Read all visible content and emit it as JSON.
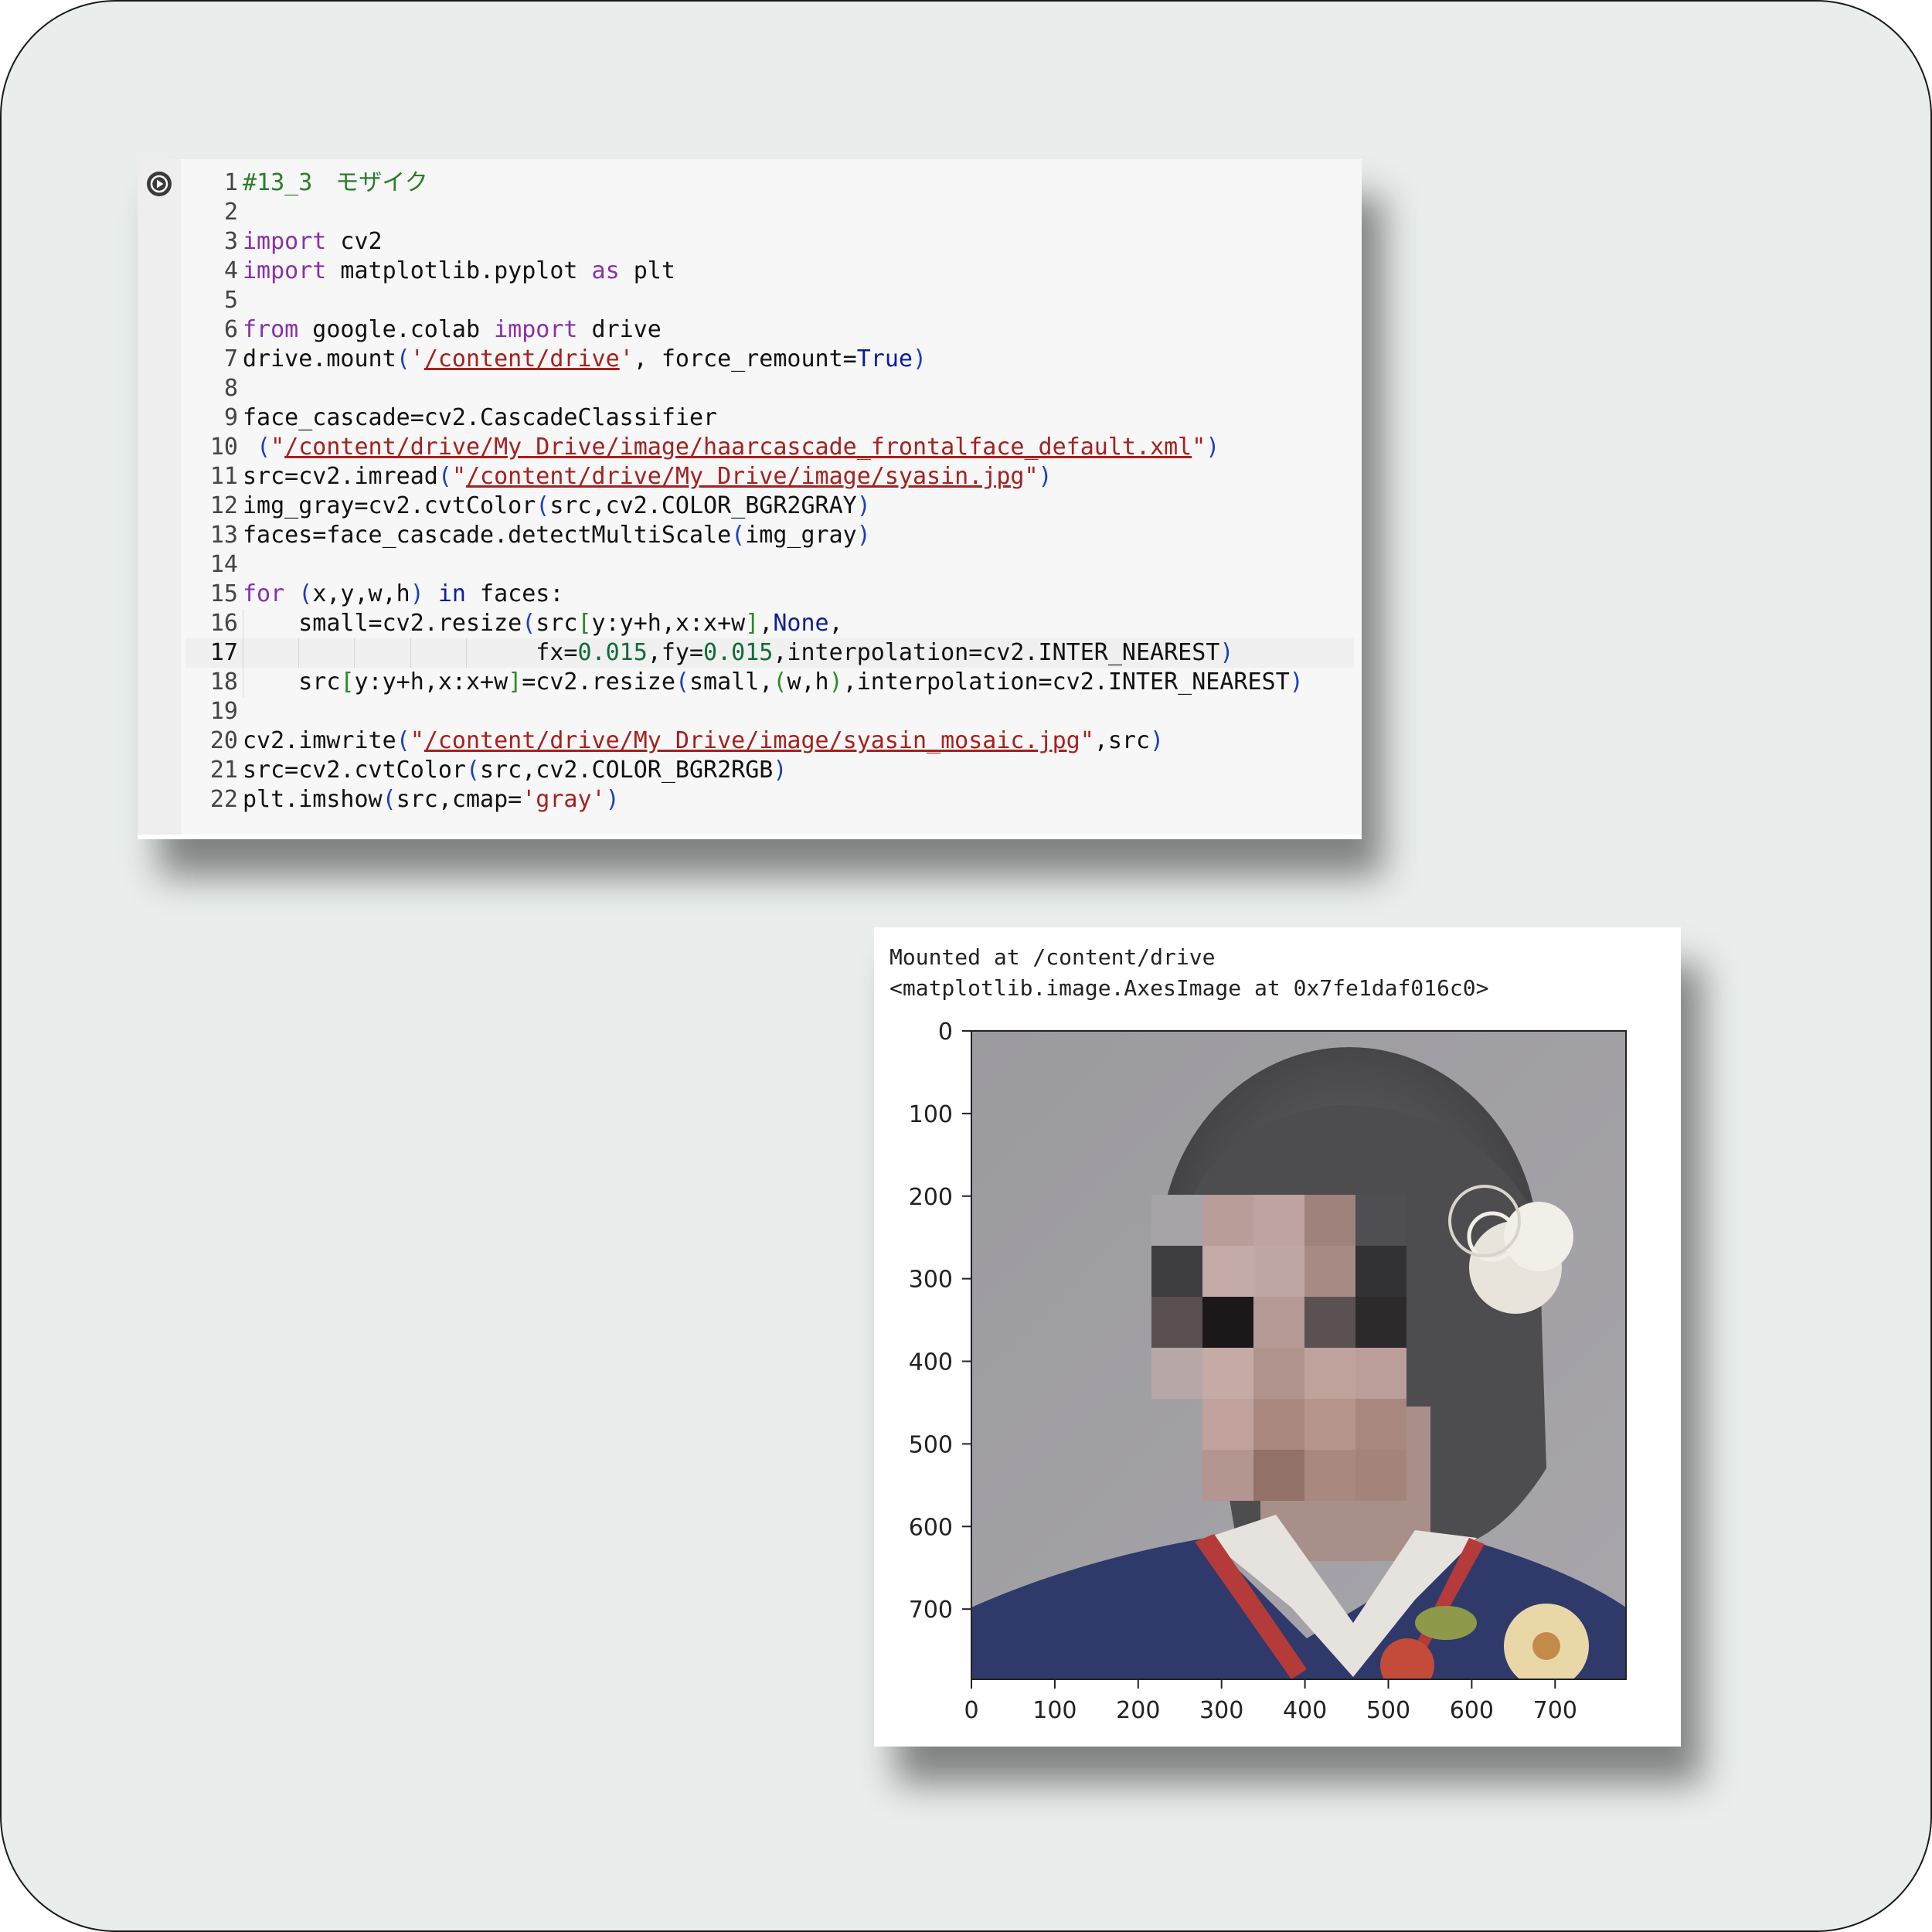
{
  "code_cell": {
    "run_button_icon": "play-icon",
    "lines": [
      {
        "n": "1",
        "html": "<span class='cmt'>#13_3　モザイク</span>"
      },
      {
        "n": "2",
        "html": ""
      },
      {
        "n": "3",
        "html": "<span class='kw'>import</span> cv2"
      },
      {
        "n": "4",
        "html": "<span class='kw'>import</span> matplotlib.pyplot <span class='kw'>as</span> plt"
      },
      {
        "n": "5",
        "html": ""
      },
      {
        "n": "6",
        "html": "<span class='kw'>from</span> google.colab <span class='kw'>import</span> drive"
      },
      {
        "n": "7",
        "html": "drive.mount<span class='br'>(</span><span class='str'>'<u>/content/drive</u>'</span>, force_remount=<span class='kw2'>True</span><span class='br'>)</span>"
      },
      {
        "n": "8",
        "html": ""
      },
      {
        "n": "9",
        "html": "face_cascade=cv2.CascadeClassifier"
      },
      {
        "n": "10",
        "html": " <span class='br'>(</span><span class='str'>\"<u>/content/drive/My Drive/image/haarcascade_frontalface_default.xml</u>\"</span><span class='br'>)</span>"
      },
      {
        "n": "11",
        "html": "src=cv2.imread<span class='br'>(</span><span class='str'>\"<u>/content/drive/My Drive/image/syasin.jpg</u>\"</span><span class='br'>)</span>"
      },
      {
        "n": "12",
        "html": "img_gray=cv2.cvtColor<span class='br'>(</span>src,cv2.COLOR_BGR2GRAY<span class='br'>)</span>"
      },
      {
        "n": "13",
        "html": "faces=face_cascade.detectMultiScale<span class='br'>(</span>img_gray<span class='br'>)</span>"
      },
      {
        "n": "14",
        "html": ""
      },
      {
        "n": "15",
        "html": "<span class='kw'>for</span> <span class='br'>(</span>x,y,w,h<span class='br'>)</span> <span class='kw2'>in</span> faces:"
      },
      {
        "n": "16",
        "html": "    small=cv2.resize<span class='br'>(</span>src<span class='br-g'>[</span>y:y+h,x:x+w<span class='br-g'>]</span>,<span class='kw2'>None</span>,"
      },
      {
        "n": "17",
        "html": "                     fx=<span class='num'>0.015</span>,fy=<span class='num'>0.015</span>,interpolation=cv2.INTER_NEAREST<span class='br'>)</span>",
        "active": true
      },
      {
        "n": "18",
        "html": "    src<span class='br-g'>[</span>y:y+h,x:x+w<span class='br-g'>]</span>=cv2.resize<span class='br'>(</span>small,<span class='br-g'>(</span>w,h<span class='br-g'>)</span>,interpolation=cv2.INTER_NEAREST<span class='br'>)</span>"
      },
      {
        "n": "19",
        "html": ""
      },
      {
        "n": "20",
        "html": "cv2.imwrite<span class='br'>(</span><span class='str'>\"<u>/content/drive/My Drive/image/syasin_mosaic.jpg</u>\"</span>,src<span class='br'>)</span>"
      },
      {
        "n": "21",
        "html": "src=cv2.cvtColor<span class='br'>(</span>src,cv2.COLOR_BGR2RGB<span class='br'>)</span>"
      },
      {
        "n": "22",
        "html": "plt.imshow<span class='br'>(</span>src,cmap=<span class='str'>'gray'</span><span class='br'>)</span>"
      }
    ]
  },
  "output": {
    "line1": "Mounted at /content/drive",
    "line2": "<matplotlib.image.AxesImage at 0x7fe1daf016c0>",
    "plot": {
      "x_ticks": [
        "0",
        "100",
        "200",
        "300",
        "400",
        "500",
        "600",
        "700"
      ],
      "y_ticks": [
        "0",
        "100",
        "200",
        "300",
        "400",
        "500",
        "600",
        "700"
      ],
      "image_description_icon": "mosaic-portrait-image"
    }
  }
}
